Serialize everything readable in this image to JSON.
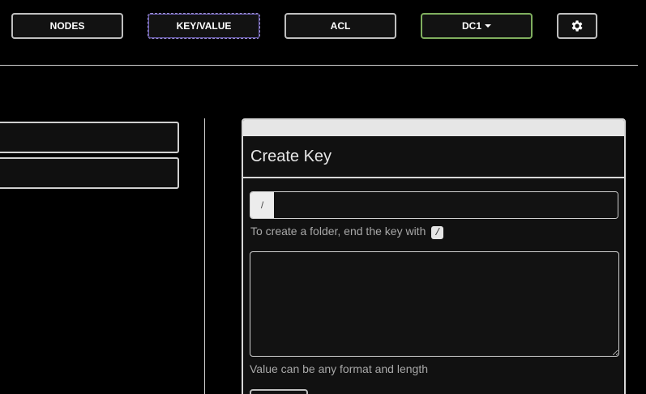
{
  "nav": {
    "nodes_label": "NODES",
    "kv_label": "KEY/VALUE",
    "acl_label": "ACL",
    "dc_label": "DC1",
    "settings_icon": "gear-icon"
  },
  "create_key": {
    "title": "Create Key",
    "key_prefix": "/",
    "key_value": "",
    "key_hint": "To create a folder, end the key with",
    "key_hint_code": "/",
    "value_text": "",
    "value_hint": "Value can be any format and length",
    "create_button_label": ""
  },
  "colors": {
    "background": "#000000",
    "panel": "#111111",
    "border": "#cfcfcf",
    "dc_accent": "#7fae5e",
    "active_tab_accent": "#9b8fd9"
  }
}
